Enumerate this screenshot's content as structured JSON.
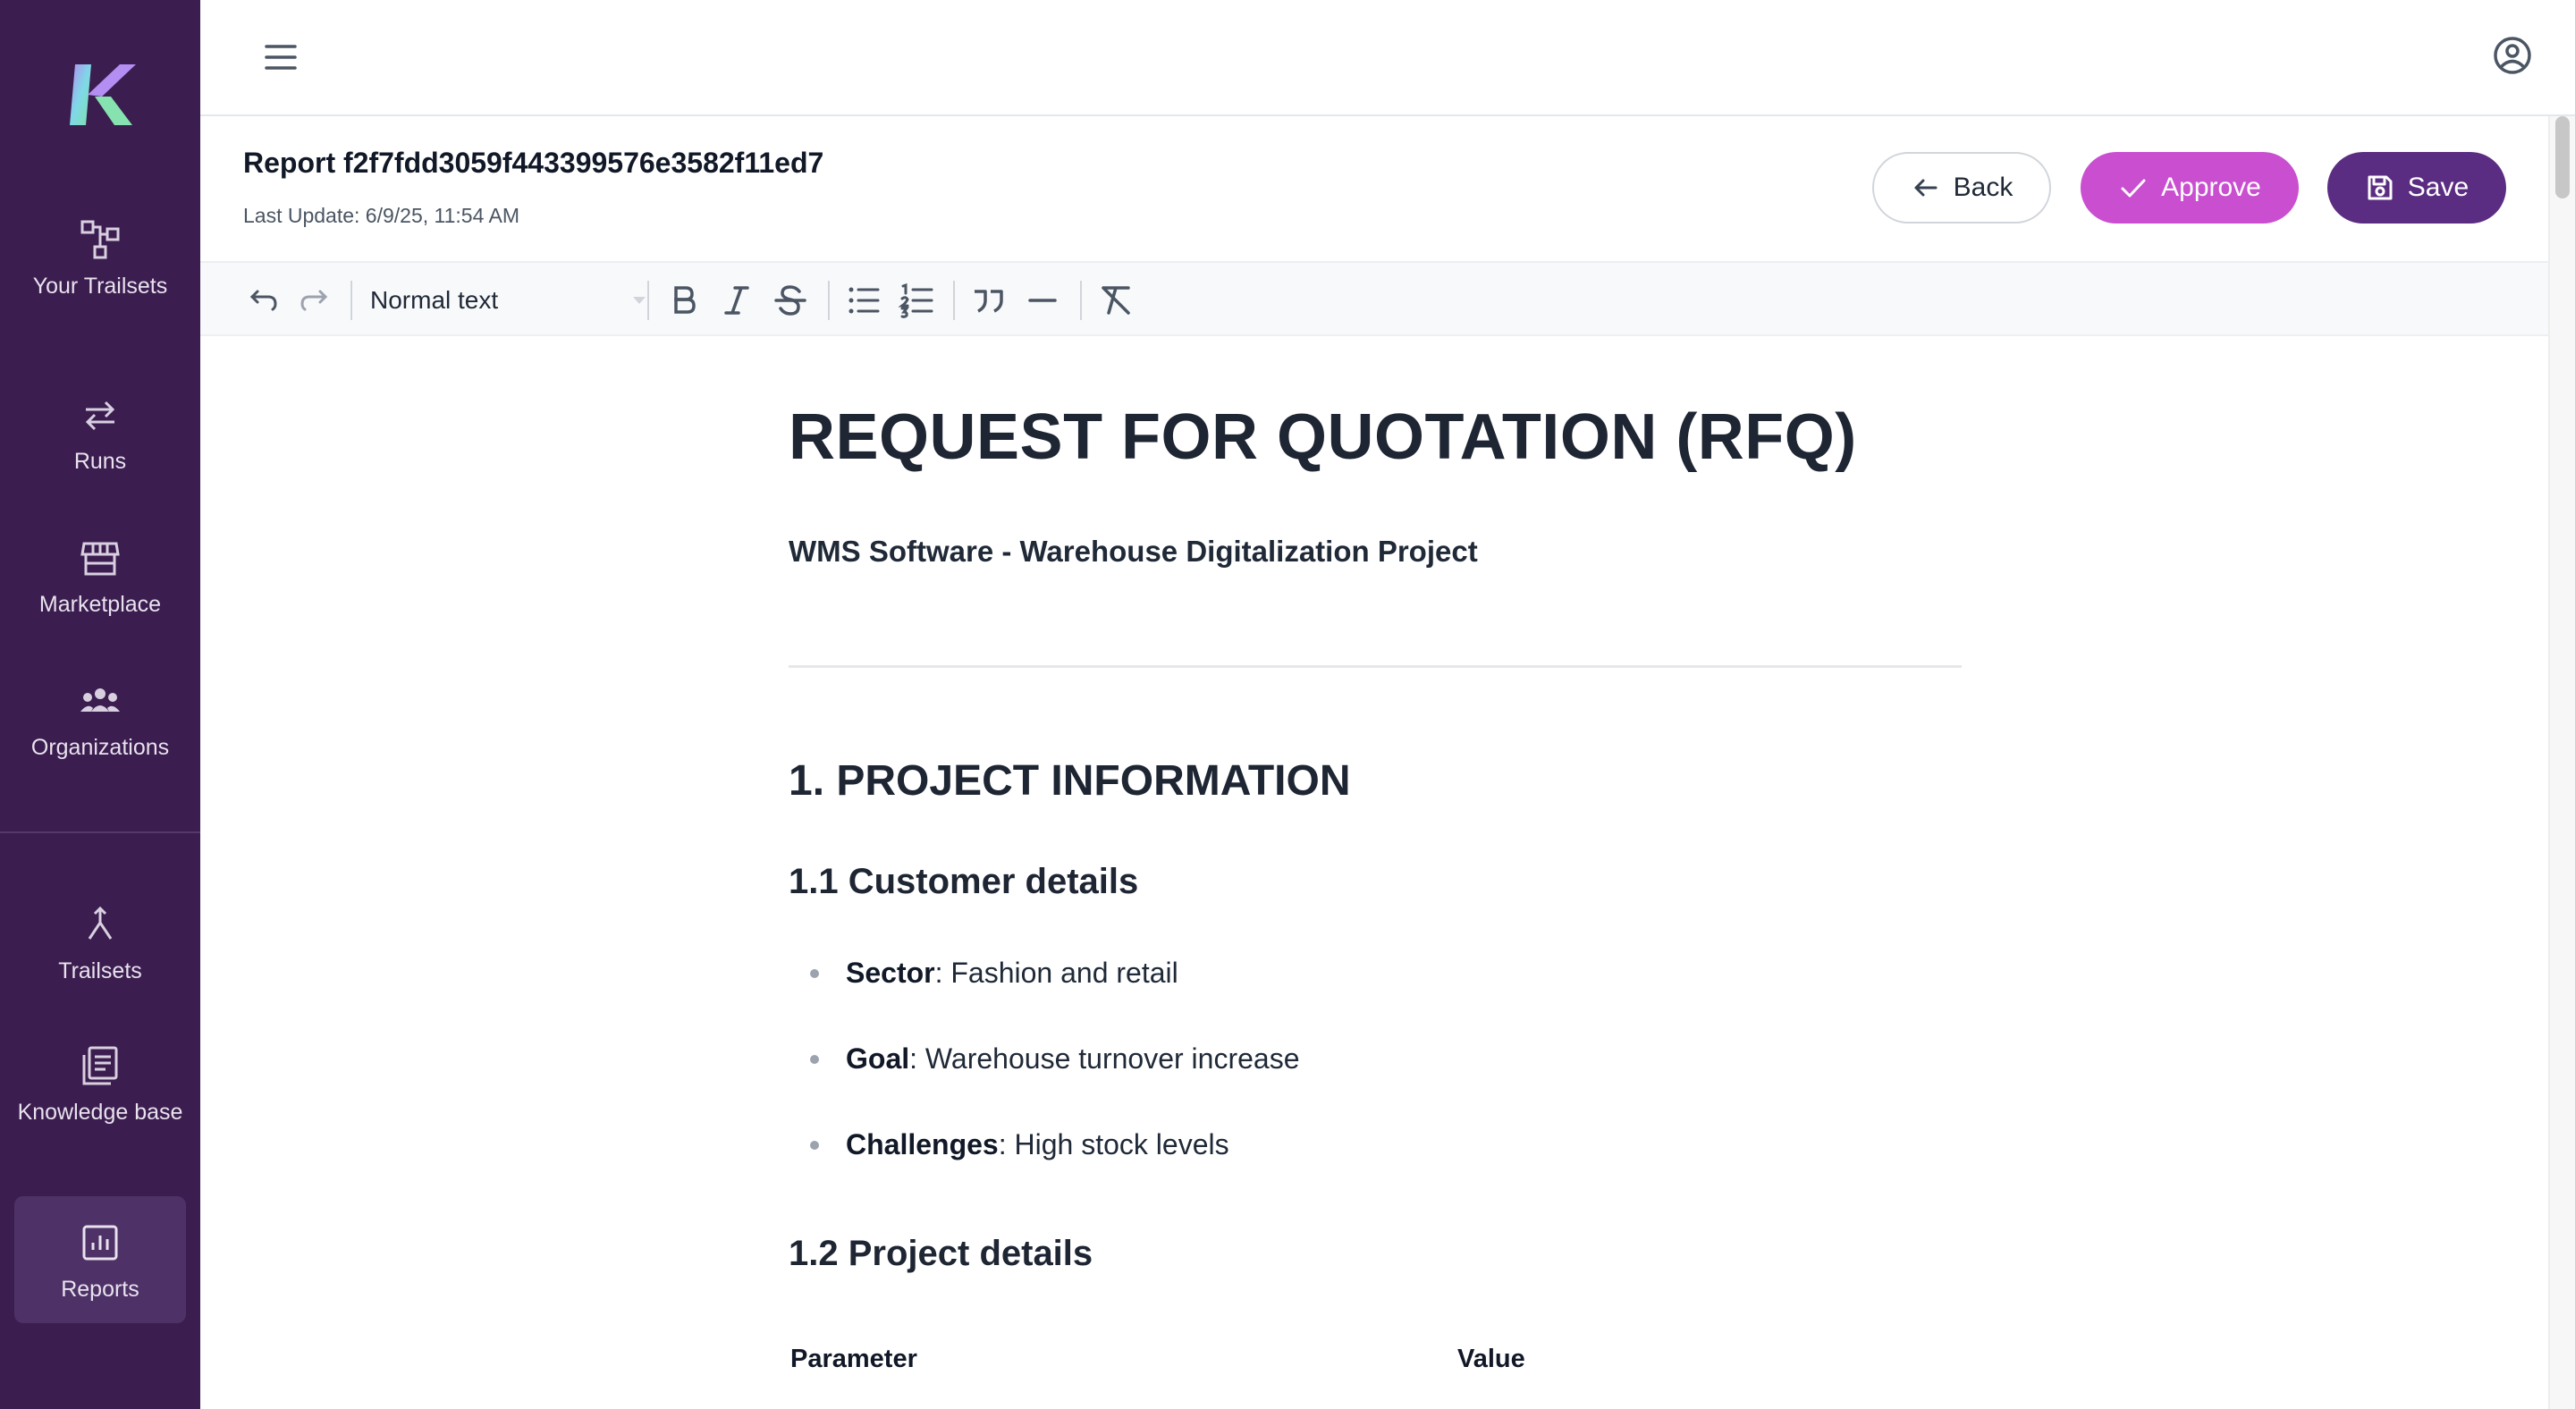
{
  "sidebar": {
    "items": [
      {
        "label": "Your Trailsets",
        "icon": "trailsets-flow-icon"
      },
      {
        "label": "Runs",
        "icon": "runs-arrows-icon"
      },
      {
        "label": "Marketplace",
        "icon": "store-icon"
      },
      {
        "label": "Organizations",
        "icon": "group-icon"
      },
      {
        "label": "Trailsets",
        "icon": "merge-icon"
      },
      {
        "label": "Knowledge base",
        "icon": "library-icon"
      },
      {
        "label": "Reports",
        "icon": "chart-icon"
      }
    ],
    "active": "Reports"
  },
  "header": {
    "title": "Report f2f7fdd3059f443399576e3582f11ed7",
    "last_update": "Last Update: 6/9/25, 11:54 AM",
    "buttons": {
      "back": "Back",
      "approve": "Approve",
      "save": "Save"
    }
  },
  "toolbar": {
    "text_style": "Normal text"
  },
  "document": {
    "title": "REQUEST FOR QUOTATION (RFQ)",
    "subtitle": "WMS Software - Warehouse Digitalization Project",
    "section1": "1. PROJECT INFORMATION",
    "sub1_1": "1.1 Customer details",
    "customer_details": [
      {
        "key": "Sector",
        "value": ": Fashion and retail"
      },
      {
        "key": "Goal",
        "value": ": Warehouse turnover increase"
      },
      {
        "key": "Challenges",
        "value": ": High stock levels"
      }
    ],
    "sub1_2": "1.2 Project details",
    "table_headers": [
      "Parameter",
      "Value"
    ]
  },
  "colors": {
    "sidebar_bg": "#3b1d4f",
    "approve": "#c94fd0",
    "save": "#5b2d82"
  }
}
